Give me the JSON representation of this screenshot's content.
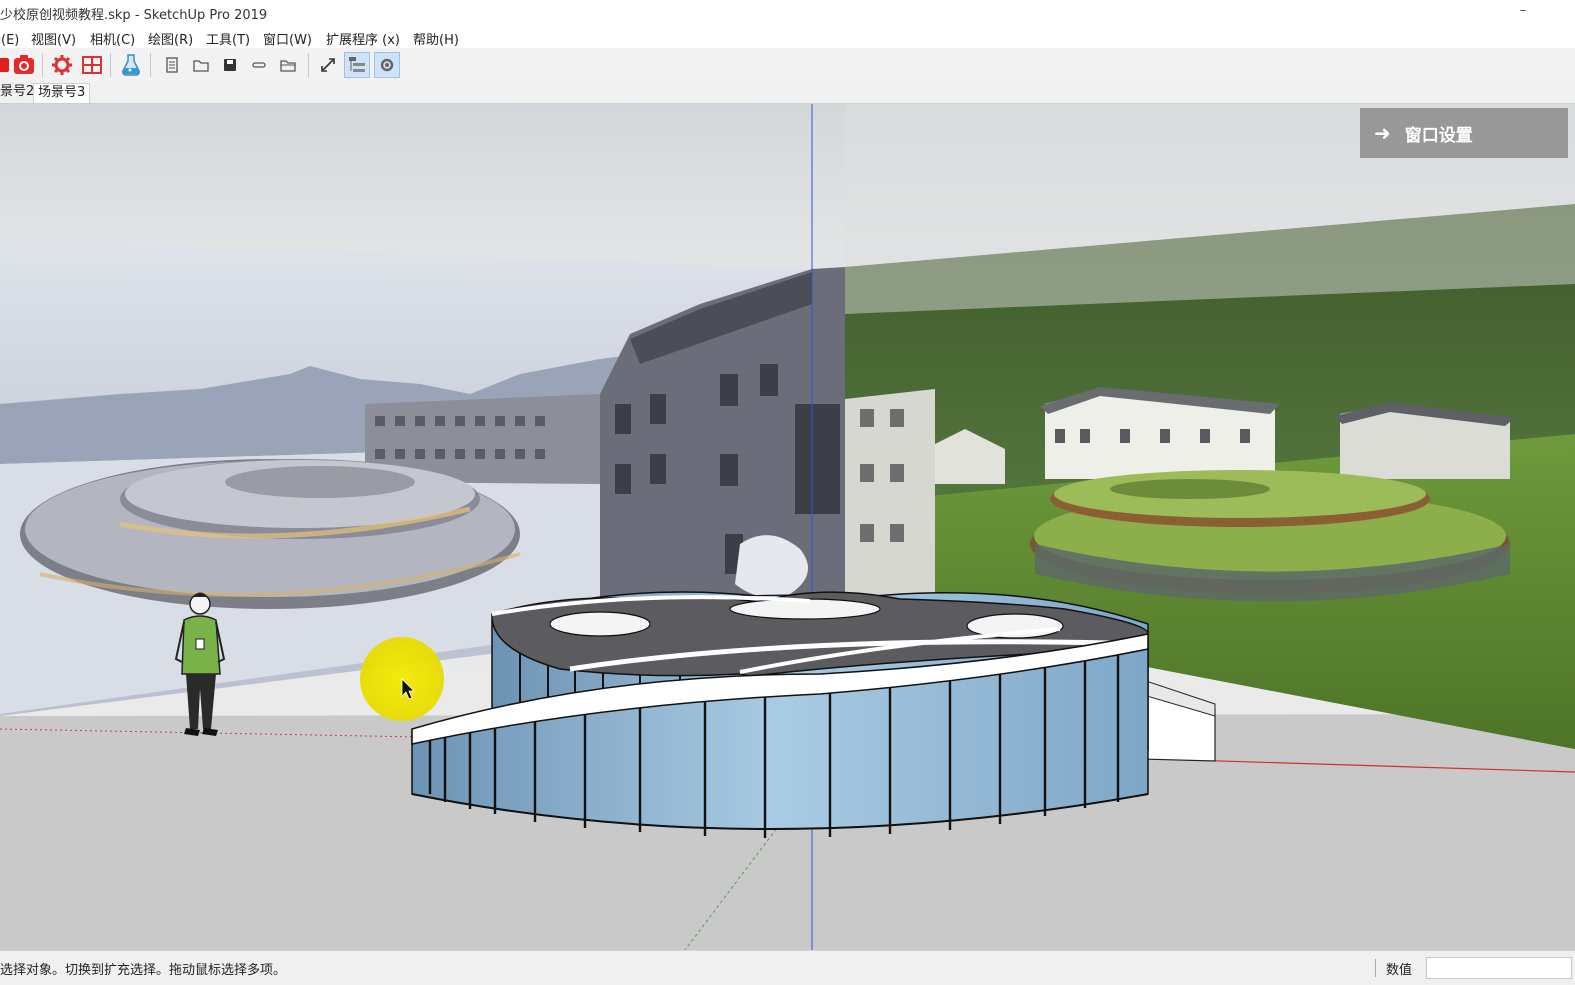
{
  "window": {
    "title": "少校原创视频教程.skp - SketchUp Pro 2019",
    "minimize_glyph": "–"
  },
  "menu": [
    {
      "label": "编(E)"
    },
    {
      "label": "视图(V)"
    },
    {
      "label": "相机(C)"
    },
    {
      "label": "绘图(R)"
    },
    {
      "label": "工具(T)"
    },
    {
      "label": "窗口(W)"
    },
    {
      "label": "扩展程序 (x)"
    },
    {
      "label": "帮助(H)"
    }
  ],
  "toolbar": {
    "buttons": [
      {
        "icon": "red-square-icon"
      },
      {
        "icon": "camera-icon"
      },
      {
        "icon": "gear-red-icon"
      },
      {
        "icon": "grid-table-icon"
      },
      {
        "icon": "flask-icon"
      },
      {
        "icon": "document-icon"
      },
      {
        "icon": "folder-icon"
      },
      {
        "icon": "save-icon"
      },
      {
        "icon": "link-icon"
      },
      {
        "icon": "open-folder-icon"
      },
      {
        "icon": "expand-icon"
      },
      {
        "icon": "outliner-icon",
        "active": true
      },
      {
        "icon": "settings-gear-icon",
        "active": true
      }
    ]
  },
  "scenes": {
    "tabs": [
      {
        "label": "景号2"
      },
      {
        "label": "场景号3",
        "active": true
      }
    ]
  },
  "viewport": {
    "overlay_button": {
      "icon": "arrow-right-icon",
      "label": "窗口设置"
    },
    "colors": {
      "glass": "#8fb8d6",
      "roof": "#5c5c60",
      "slab_edge": "#ffffff",
      "cursor_highlight": "#f2e600"
    }
  },
  "statusbar": {
    "message": "选择对象。切换到扩充选择。拖动鼠标选择多项。",
    "measurements_label": "数值",
    "measurements_value": ""
  }
}
